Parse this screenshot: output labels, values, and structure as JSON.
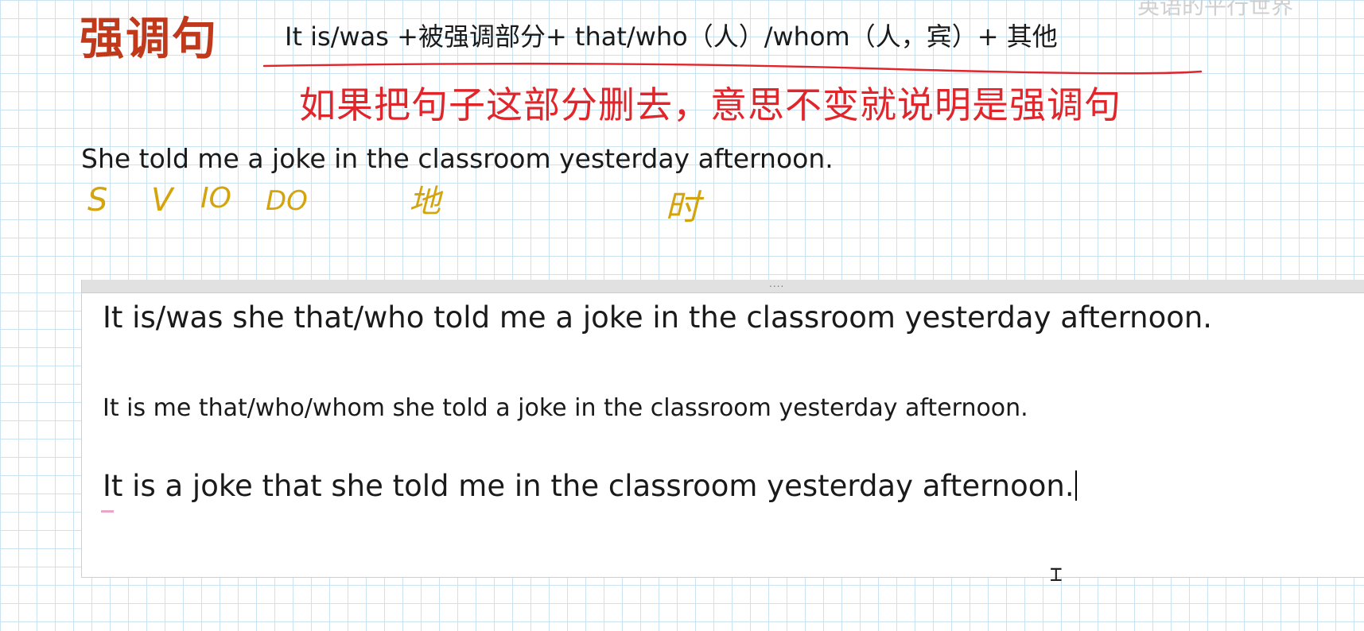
{
  "header": {
    "title": "强调句",
    "formula": "It is/was +被强调部分+ that/who（人）/whom（人，宾）+ 其他",
    "hint": "如果把句子这部分删去，意思不变就说明是强调句",
    "watermark": "英语的平行世界"
  },
  "base_sentence": "She told me a joke in the classroom yesterday afternoon.",
  "annotations": {
    "s": "S",
    "v": "V",
    "io": "IO",
    "do": "DO",
    "di": "地",
    "shi": "时"
  },
  "colors": {
    "title": "#c0391b",
    "hint": "#e0252b",
    "annotation": "#d4a40c",
    "grid": "#c9e3f3"
  },
  "editor": {
    "grip": "....",
    "lines": [
      "It is/was she that/who told me a joke in the classroom yesterday afternoon.",
      "It is me that/who/whom she told a joke in the classroom yesterday afternoon.",
      "It is a joke that she told me in the classroom yesterday afternoon."
    ]
  },
  "cursor_icon": "text-cursor-icon"
}
